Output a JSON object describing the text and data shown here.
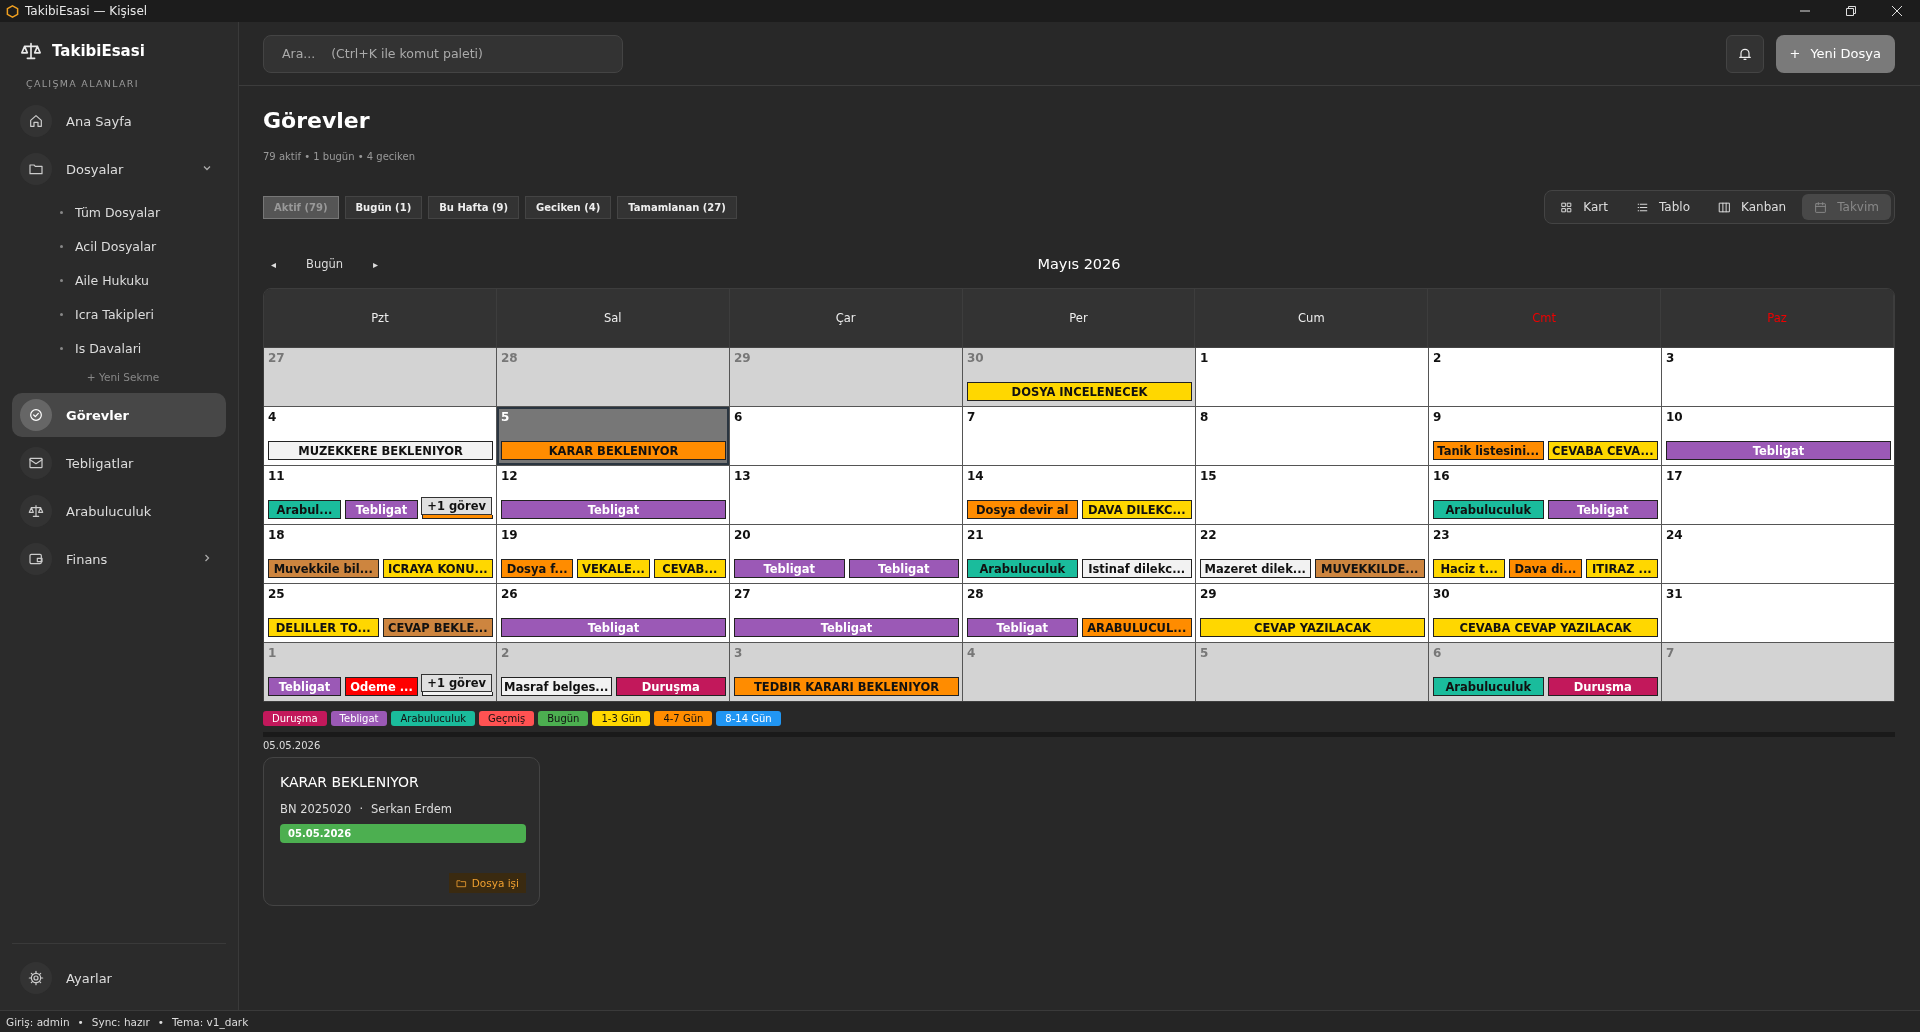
{
  "window": {
    "title": "TakibiEsasi — Kişisel"
  },
  "sidebar": {
    "brand": "TakibiEsasi",
    "section": "ÇALIŞMA ALANLARI",
    "items": [
      {
        "label": "Ana Sayfa",
        "selected": false
      },
      {
        "label": "Dosyalar",
        "selected": false,
        "expanded": true,
        "children": [
          {
            "label": "Tüm Dosyalar"
          },
          {
            "label": "Acil Dosyalar"
          },
          {
            "label": "Aile Hukuku"
          },
          {
            "label": "Icra Takipleri"
          },
          {
            "label": "Is Davalari"
          }
        ],
        "add_label": "+ Yeni Sekme"
      },
      {
        "label": "Görevler",
        "selected": true
      },
      {
        "label": "Tebligatlar",
        "selected": false
      },
      {
        "label": "Arabuluculuk",
        "selected": false
      },
      {
        "label": "Finans",
        "selected": false,
        "expanded": false
      }
    ],
    "footer": {
      "label": "Ayarlar"
    }
  },
  "header": {
    "search": {
      "placeholder": "Ara...    (Ctrl+K ile komut paleti)"
    },
    "new_button": {
      "icon": "+",
      "label": "Yeni Dosya"
    }
  },
  "page": {
    "title": "Görevler",
    "summary": "79 aktif • 1 bugün • 4 geciken"
  },
  "filters": [
    {
      "label": "Aktif (79)",
      "selected": true
    },
    {
      "label": "Bugün (1)",
      "selected": false
    },
    {
      "label": "Bu Hafta (9)",
      "selected": false
    },
    {
      "label": "Geciken (4)",
      "selected": false
    },
    {
      "label": "Tamamlanan (27)",
      "selected": false
    }
  ],
  "views": [
    {
      "label": "Kart",
      "selected": false
    },
    {
      "label": "Tablo",
      "selected": false
    },
    {
      "label": "Kanban",
      "selected": false
    },
    {
      "label": "Takvim",
      "selected": true
    }
  ],
  "calendar": {
    "prev": "◂",
    "today_label": "Bugün",
    "next": "▸",
    "month": "Mayıs 2026",
    "weekdays": [
      {
        "label": "Pzt",
        "weekend": false
      },
      {
        "label": "Sal",
        "weekend": false
      },
      {
        "label": "Çar",
        "weekend": false
      },
      {
        "label": "Per",
        "weekend": false
      },
      {
        "label": "Cum",
        "weekend": false
      },
      {
        "label": "Cmt",
        "weekend": true
      },
      {
        "label": "Paz",
        "weekend": true
      }
    ],
    "weeks": [
      [
        {
          "day": "27",
          "in_month": false,
          "today": false
        },
        {
          "day": "28",
          "in_month": false,
          "today": false
        },
        {
          "day": "29",
          "in_month": false,
          "today": false
        },
        {
          "day": "30",
          "in_month": false,
          "today": false,
          "events": [
            {
              "text": "DOSYA INCELENECEK",
              "color": "#ffd700"
            }
          ]
        },
        {
          "day": "1",
          "in_month": true,
          "today": false
        },
        {
          "day": "2",
          "in_month": true,
          "today": false
        },
        {
          "day": "3",
          "in_month": true,
          "today": false
        }
      ],
      [
        {
          "day": "4",
          "in_month": true,
          "today": false,
          "events": [
            {
              "text": "MUZEKKERE BEKLENIYOR",
              "color": "#f2f2f2"
            }
          ]
        },
        {
          "day": "5",
          "in_month": true,
          "today": true,
          "events": [
            {
              "text": "KARAR BEKLENIYOR",
              "color": "#ff8c00"
            }
          ]
        },
        {
          "day": "6",
          "in_month": true,
          "today": false
        },
        {
          "day": "7",
          "in_month": true,
          "today": false
        },
        {
          "day": "8",
          "in_month": true,
          "today": false
        },
        {
          "day": "9",
          "in_month": true,
          "today": false,
          "events": [
            {
              "text": "Tanik listesini...",
              "color": "#ff8c00"
            },
            {
              "text": "CEVABA CEVA...",
              "color": "#ffd700"
            }
          ]
        },
        {
          "day": "10",
          "in_month": true,
          "today": false,
          "events": [
            {
              "text": "Tebligat",
              "color": "#9b59b6"
            }
          ]
        }
      ],
      [
        {
          "day": "11",
          "in_month": true,
          "today": false,
          "events": [
            {
              "text": "Arabul...",
              "color": "#1abc9c"
            },
            {
              "text": "Tebligat",
              "color": "#9b59b6"
            },
            {
              "color": "#ff8c00"
            }
          ],
          "more": "+1 görev"
        },
        {
          "day": "12",
          "in_month": true,
          "today": false,
          "events": [
            {
              "text": "Tebligat",
              "color": "#9b59b6"
            }
          ]
        },
        {
          "day": "13",
          "in_month": true,
          "today": false
        },
        {
          "day": "14",
          "in_month": true,
          "today": false,
          "events": [
            {
              "text": "Dosya devir al",
              "color": "#ff8c00"
            },
            {
              "text": "DAVA DILEKC...",
              "color": "#ffd700"
            }
          ]
        },
        {
          "day": "15",
          "in_month": true,
          "today": false
        },
        {
          "day": "16",
          "in_month": true,
          "today": false,
          "events": [
            {
              "text": "Arabuluculuk",
              "color": "#1abc9c"
            },
            {
              "text": "Tebligat",
              "color": "#9b59b6"
            }
          ]
        },
        {
          "day": "17",
          "in_month": true,
          "today": false
        }
      ],
      [
        {
          "day": "18",
          "in_month": true,
          "today": false,
          "events": [
            {
              "text": "Muvekkile bil...",
              "color": "#cd853f"
            },
            {
              "text": "ICRAYA KONU...",
              "color": "#ffd700"
            }
          ]
        },
        {
          "day": "19",
          "in_month": true,
          "today": false,
          "events": [
            {
              "text": "Dosya f...",
              "color": "#ff8c00"
            },
            {
              "text": "VEKALE...",
              "color": "#ffd700"
            },
            {
              "text": "CEVAB...",
              "color": "#ffd700"
            }
          ]
        },
        {
          "day": "20",
          "in_month": true,
          "today": false,
          "events": [
            {
              "text": "Tebligat",
              "color": "#9b59b6"
            },
            {
              "text": "Tebligat",
              "color": "#9b59b6"
            }
          ]
        },
        {
          "day": "21",
          "in_month": true,
          "today": false,
          "events": [
            {
              "text": "Arabuluculuk",
              "color": "#1abc9c"
            },
            {
              "text": "Istinaf dilekc...",
              "color": "#f2f2f2"
            }
          ]
        },
        {
          "day": "22",
          "in_month": true,
          "today": false,
          "events": [
            {
              "text": "Mazeret dilek...",
              "color": "#f2f2f2"
            },
            {
              "text": "MUVEKKILDE...",
              "color": "#cd853f"
            }
          ]
        },
        {
          "day": "23",
          "in_month": true,
          "today": false,
          "events": [
            {
              "text": "Haciz t...",
              "color": "#ffd700"
            },
            {
              "text": "Dava di...",
              "color": "#ff8c00"
            },
            {
              "text": "ITIRAZ ...",
              "color": "#ffd700"
            }
          ]
        },
        {
          "day": "24",
          "in_month": true,
          "today": false
        }
      ],
      [
        {
          "day": "25",
          "in_month": true,
          "today": false,
          "events": [
            {
              "text": "DELILLER TO...",
              "color": "#ffd700"
            },
            {
              "text": "CEVAP BEKLE...",
              "color": "#cd853f"
            }
          ]
        },
        {
          "day": "26",
          "in_month": true,
          "today": false,
          "events": [
            {
              "text": "Tebligat",
              "color": "#9b59b6"
            }
          ]
        },
        {
          "day": "27",
          "in_month": true,
          "today": false,
          "events": [
            {
              "text": "Tebligat",
              "color": "#9b59b6"
            }
          ]
        },
        {
          "day": "28",
          "in_month": true,
          "today": false,
          "events": [
            {
              "text": "Tebligat",
              "color": "#9b59b6"
            },
            {
              "text": "ARABULUCUL...",
              "color": "#ff8c00"
            }
          ]
        },
        {
          "day": "29",
          "in_month": true,
          "today": false,
          "events": [
            {
              "text": "CEVAP YAZILACAK",
              "color": "#ffd700"
            }
          ]
        },
        {
          "day": "30",
          "in_month": true,
          "today": false,
          "events": [
            {
              "text": "CEVABA CEVAP YAZILACAK",
              "color": "#ffd700"
            }
          ]
        },
        {
          "day": "31",
          "in_month": true,
          "today": false
        }
      ],
      [
        {
          "day": "1",
          "in_month": false,
          "today": false,
          "events": [
            {
              "text": "Tebligat",
              "color": "#9b59b6"
            },
            {
              "text": "Odeme ...",
              "color": "#ff0000"
            },
            {
              "color": "#f2f2f2"
            }
          ],
          "more": "+1 görev"
        },
        {
          "day": "2",
          "in_month": false,
          "today": false,
          "events": [
            {
              "text": "Masraf belges...",
              "color": "#f2f2f2"
            },
            {
              "text": "Duruşma",
              "color": "#c2185b"
            }
          ]
        },
        {
          "day": "3",
          "in_month": false,
          "today": false,
          "events": [
            {
              "text": "TEDBIR KARARI BEKLENIYOR",
              "color": "#ff8c00"
            }
          ]
        },
        {
          "day": "4",
          "in_month": false,
          "today": false
        },
        {
          "day": "5",
          "in_month": false,
          "today": false
        },
        {
          "day": "6",
          "in_month": false,
          "today": false,
          "events": [
            {
              "text": "Arabuluculuk",
              "color": "#1abc9c"
            },
            {
              "text": "Duruşma",
              "color": "#c2185b"
            }
          ]
        },
        {
          "day": "7",
          "in_month": false,
          "today": false
        }
      ]
    ]
  },
  "legend": [
    {
      "label": "Duruşma",
      "color": "#c2185b"
    },
    {
      "label": "Tebligat",
      "color": "#9b59b6"
    },
    {
      "label": "Arabuluculuk",
      "color": "#1abc9c"
    },
    {
      "label": "Geçmiş",
      "color": "#ff5252"
    },
    {
      "label": "Bugün",
      "color": "#4caf50"
    },
    {
      "label": "1-3 Gün",
      "color": "#ffd700"
    },
    {
      "label": "4-7 Gün",
      "color": "#ff8c00"
    },
    {
      "label": "8-14 Gün",
      "color": "#2196f3"
    }
  ],
  "selected_date": "05.05.2026",
  "task_card": {
    "title": "KARAR BEKLENIYOR",
    "case_no": "BN 2025020",
    "separator": "·",
    "client": "Serkan Erdem",
    "due": "05.05.2026",
    "tag": "Dosya işi"
  },
  "status_bar": [
    "Giriş: admin",
    "•",
    "Sync: hazır",
    "•",
    "Tema: v1_dark"
  ]
}
